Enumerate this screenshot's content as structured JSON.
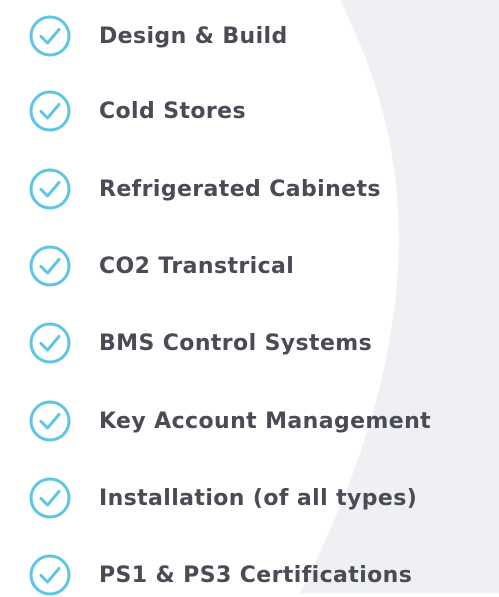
{
  "colors": {
    "check": "#5ec5e3",
    "text": "#4a4b55",
    "background": "#ffffff",
    "shape": "#eef0f4"
  },
  "checklist": {
    "items": [
      {
        "label": "Design & Build",
        "icon": "check-circle-icon"
      },
      {
        "label": "Cold Stores",
        "icon": "check-circle-icon"
      },
      {
        "label": "Refrigerated Cabinets",
        "icon": "check-circle-icon"
      },
      {
        "label": "CO2 Transtrical",
        "icon": "check-circle-icon"
      },
      {
        "label": "BMS Control Systems",
        "icon": "check-circle-icon"
      },
      {
        "label": "Key Account Management",
        "icon": "check-circle-icon"
      },
      {
        "label": "Installation (of all types)",
        "icon": "check-circle-icon"
      },
      {
        "label": "PS1 & PS3 Certifications",
        "icon": "check-circle-icon"
      }
    ]
  }
}
